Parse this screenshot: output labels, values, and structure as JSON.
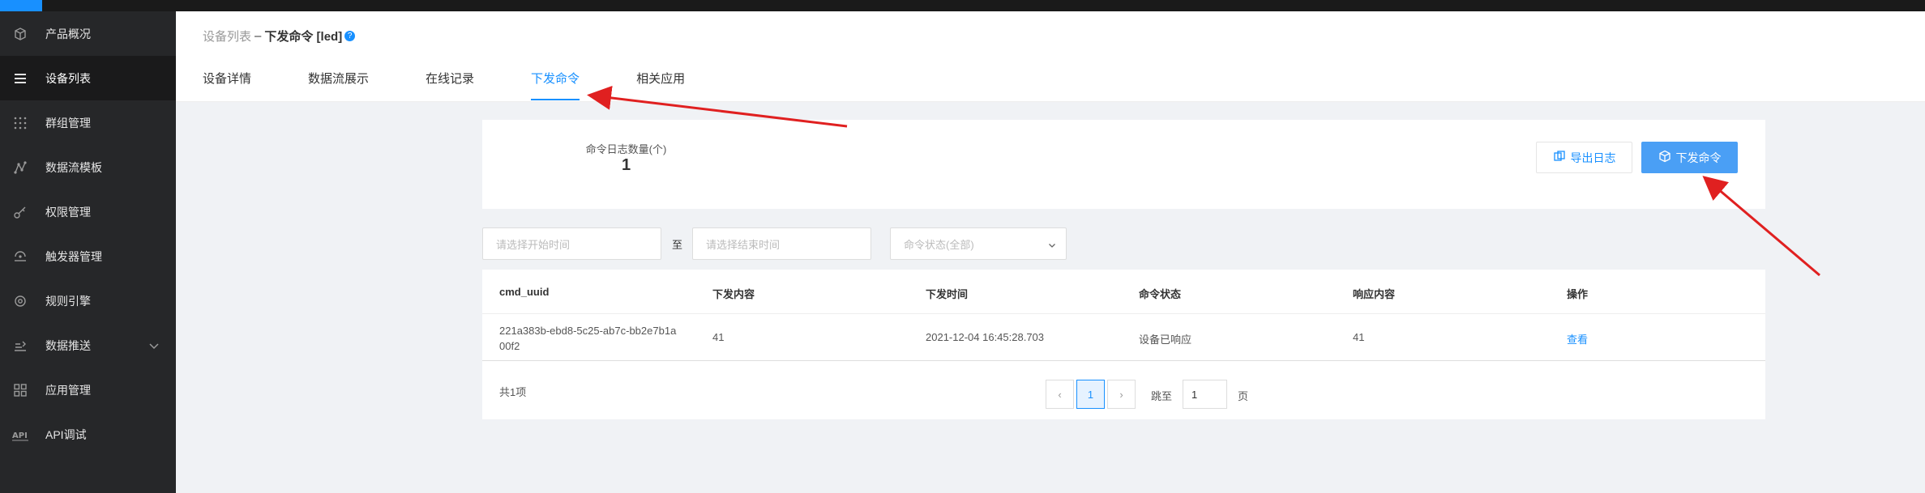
{
  "sidebar": {
    "items": [
      {
        "label": "产品概况",
        "icon": "cube-icon"
      },
      {
        "label": "设备列表",
        "icon": "list-icon"
      },
      {
        "label": "群组管理",
        "icon": "grid-dots-icon"
      },
      {
        "label": "数据流模板",
        "icon": "graph-icon"
      },
      {
        "label": "权限管理",
        "icon": "key-icon"
      },
      {
        "label": "触发器管理",
        "icon": "signal-icon"
      },
      {
        "label": "规则引擎",
        "icon": "rule-icon"
      },
      {
        "label": "数据推送",
        "icon": "push-icon"
      },
      {
        "label": "应用管理",
        "icon": "apps-icon"
      },
      {
        "label": "API调试",
        "icon": "api-icon"
      }
    ],
    "active_index": 1
  },
  "breadcrumb": {
    "parent": "设备列表",
    "separator": "–",
    "current": "下发命令 [led]"
  },
  "tabs": [
    "设备详情",
    "数据流展示",
    "在线记录",
    "下发命令",
    "相关应用"
  ],
  "active_tab": 3,
  "stats": {
    "label": "命令日志数量(个)",
    "value": "1"
  },
  "buttons": {
    "export": "导出日志",
    "send": "下发命令"
  },
  "filters": {
    "start_placeholder": "请选择开始时间",
    "to": "至",
    "end_placeholder": "请选择结束时间",
    "status_placeholder": "命令状态(全部)"
  },
  "table": {
    "headers": [
      "cmd_uuid",
      "下发内容",
      "下发时间",
      "命令状态",
      "响应内容",
      "操作"
    ],
    "rows": [
      {
        "cmd_uuid_line1": "221a383b-ebd8-5c25-ab7c-bb2e7b1a",
        "cmd_uuid_line2": "00f2",
        "content": "41",
        "time": "2021-12-04 16:45:28.703",
        "status": "设备已响应",
        "response": "41",
        "action": "查看"
      }
    ]
  },
  "pagination": {
    "total": "共1项",
    "prev": "‹",
    "current": "1",
    "next": "›",
    "jump_label": "跳至",
    "jump_value": "1",
    "page_suffix": "页"
  },
  "colors": {
    "accent": "#1890ff",
    "sidebar_bg": "#262729",
    "annotation": "#e02020"
  }
}
